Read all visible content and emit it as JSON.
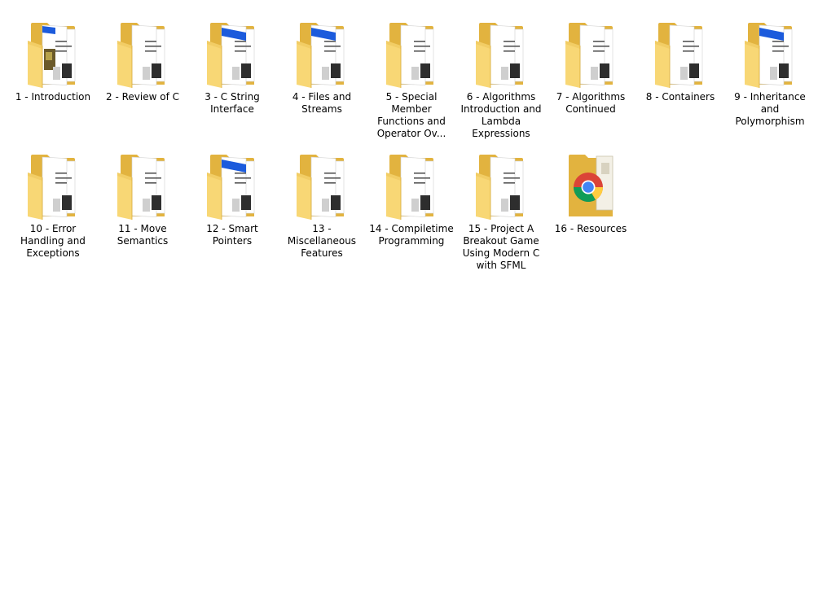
{
  "folder_colors": {
    "back": "#e2b33f",
    "front": "#f8d775",
    "front_shade": "#efc65a",
    "doc_blue": "#1c5bdc"
  },
  "items": [
    {
      "name": "1 - Introduction",
      "type": "folder",
      "preview": "photo",
      "icon": "folder-icon"
    },
    {
      "name": "2 - Review of C",
      "type": "folder",
      "preview": "text",
      "icon": "folder-icon"
    },
    {
      "name": "3 - C String Interface",
      "type": "folder",
      "preview": "blue-doc",
      "icon": "folder-icon"
    },
    {
      "name": "4 - Files and Streams",
      "type": "folder",
      "preview": "blue-doc",
      "icon": "folder-icon"
    },
    {
      "name": "5 - Special Member Functions and Operator Ov...",
      "type": "folder",
      "preview": "text",
      "icon": "folder-icon"
    },
    {
      "name": "6 - Algorithms Introduction and Lambda Expressions",
      "type": "folder",
      "preview": "text",
      "icon": "folder-icon"
    },
    {
      "name": "7 - Algorithms Continued",
      "type": "folder",
      "preview": "text",
      "icon": "folder-icon"
    },
    {
      "name": "8 - Containers",
      "type": "folder",
      "preview": "text",
      "icon": "folder-icon"
    },
    {
      "name": "9 - Inheritance and Polymorphism",
      "type": "folder",
      "preview": "blue-doc",
      "icon": "folder-icon"
    },
    {
      "name": "10 - Error Handling and Exceptions",
      "type": "folder",
      "preview": "text",
      "icon": "folder-icon"
    },
    {
      "name": "11 - Move Semantics",
      "type": "folder",
      "preview": "text",
      "icon": "folder-icon"
    },
    {
      "name": "12 - Smart Pointers",
      "type": "folder",
      "preview": "blue-doc",
      "icon": "folder-icon"
    },
    {
      "name": "13 - Miscellaneous Features",
      "type": "folder",
      "preview": "text",
      "icon": "folder-icon"
    },
    {
      "name": "14 - Compiletime Programming",
      "type": "folder",
      "preview": "text",
      "icon": "folder-icon"
    },
    {
      "name": "15 - Project A Breakout Game Using Modern C with SFML",
      "type": "folder",
      "preview": "text",
      "icon": "folder-icon"
    },
    {
      "name": "16 - Resources",
      "type": "folder",
      "preview": "chrome",
      "icon": "chrome-folder-icon"
    }
  ]
}
